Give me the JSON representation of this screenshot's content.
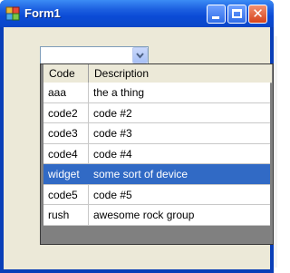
{
  "window": {
    "title": "Form1"
  },
  "combo": {
    "value": ""
  },
  "grid": {
    "columns": [
      "Code",
      "Description"
    ],
    "rows": [
      {
        "code": "aaa",
        "description": "the a thing"
      },
      {
        "code": "code2",
        "description": "code #2"
      },
      {
        "code": "code3",
        "description": "code #3"
      },
      {
        "code": "code4",
        "description": "code #4"
      },
      {
        "code": "widget",
        "description": "some sort of device"
      },
      {
        "code": "code5",
        "description": "code #5"
      },
      {
        "code": "rush",
        "description": "awesome rock group"
      }
    ],
    "selected_code": "widget"
  },
  "icons": {
    "app": "form-app-icon",
    "minimize": "minimize-icon",
    "maximize": "maximize-icon",
    "close": "close-icon",
    "dropdown": "chevron-down-icon"
  },
  "colors": {
    "selection": "#316ac5",
    "titlebar": "#0b4bd6"
  }
}
